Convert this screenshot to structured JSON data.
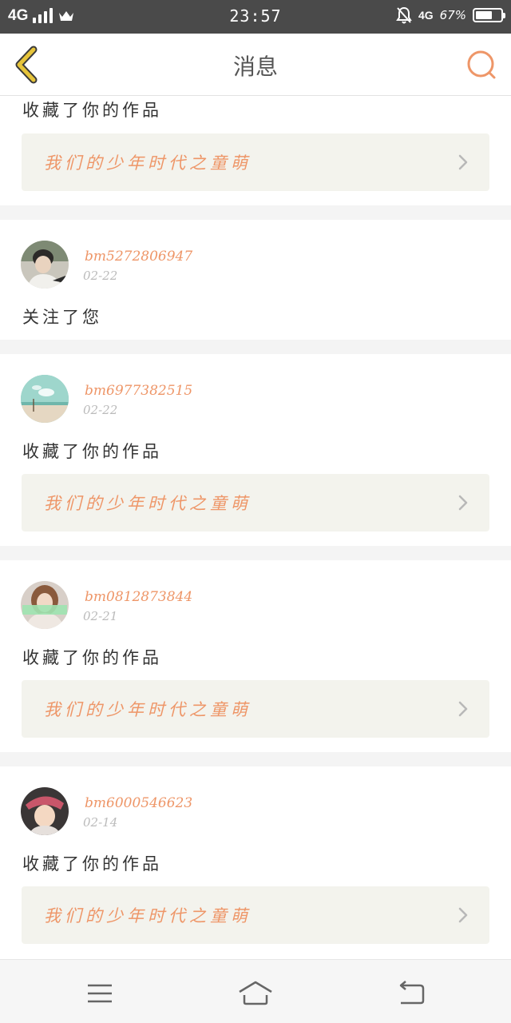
{
  "status_bar": {
    "network_left": "4G",
    "time": "23:57",
    "network_right": "4G",
    "battery_percent_label": "67%",
    "battery_level": 0.67,
    "icons": [
      "signal-bars-icon",
      "crown-icon",
      "bell-muted-icon",
      "battery-icon"
    ]
  },
  "header": {
    "title": "消息",
    "back_icon": "chevron-left-icon",
    "search_icon": "search-icon",
    "accent_color": "#ee9668",
    "back_color": "#e6c43a"
  },
  "messages": [
    {
      "action": "收藏了你的作品",
      "work_title": "我们的少年时代之童萌"
    },
    {
      "username": "bm5272806947",
      "date": "02-22",
      "action": "关注了您"
    },
    {
      "username": "bm6977382515",
      "date": "02-22",
      "action": "收藏了你的作品",
      "work_title": "我们的少年时代之童萌"
    },
    {
      "username": "bm0812873844",
      "date": "02-21",
      "action": "收藏了你的作品",
      "work_title": "我们的少年时代之童萌"
    },
    {
      "username": "bm6000546623",
      "date": "02-14",
      "action": "收藏了你的作品",
      "work_title": "我们的少年时代之童萌"
    }
  ],
  "nav_bar": {
    "icons": [
      "menu-icon",
      "home-icon",
      "back-icon"
    ]
  }
}
